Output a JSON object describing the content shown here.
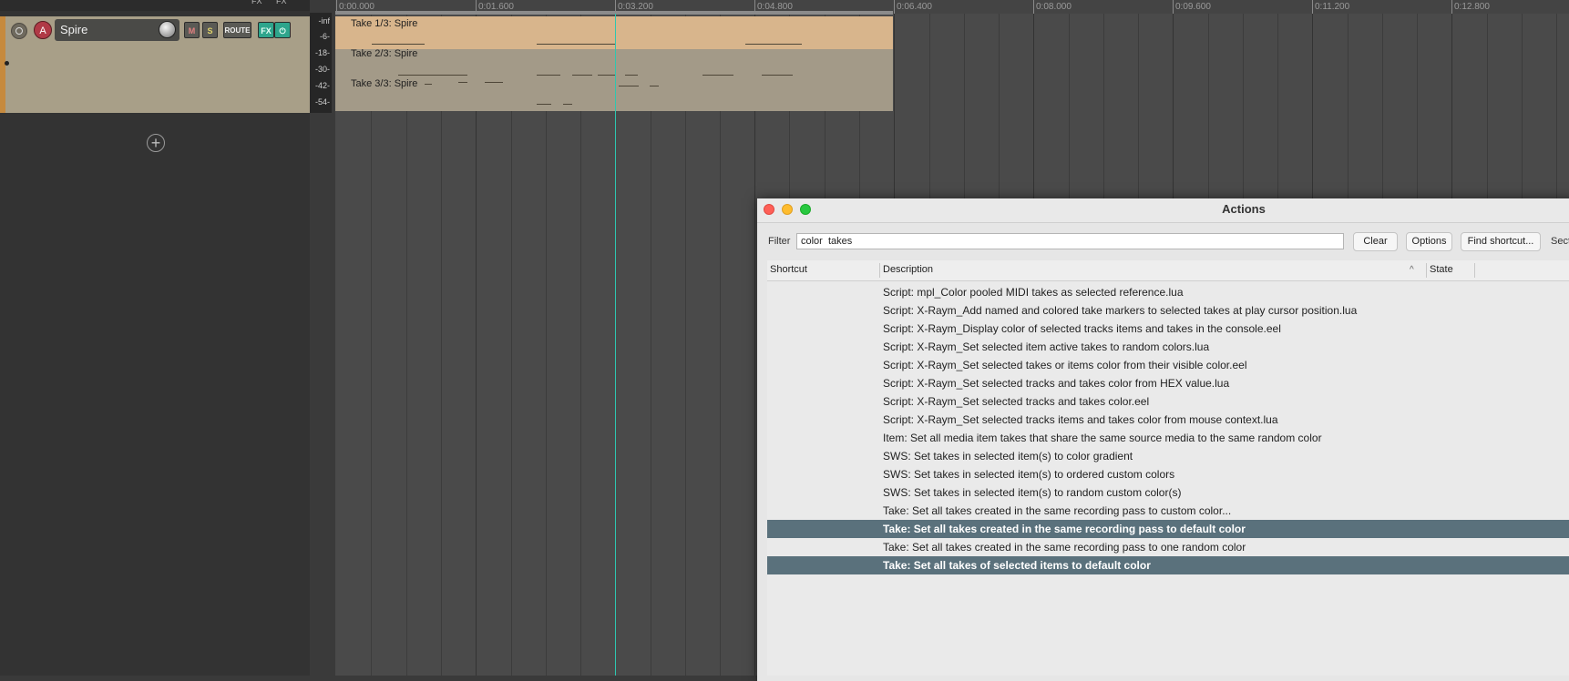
{
  "toolbar": {
    "fx_labels": [
      "FX",
      "FX"
    ]
  },
  "track": {
    "number": "A",
    "name": "Spire",
    "buttons": {
      "mute": "M",
      "solo": "S",
      "route": "ROUTE",
      "fx": "FX",
      "power": "⏻"
    },
    "meter_labels": [
      "-inf",
      "-6-",
      "-18-",
      "-30-",
      "-42-",
      "-54-"
    ]
  },
  "add_track_symbol": "+",
  "ruler": {
    "labels": [
      "0:00.000",
      "0:01.600",
      "0:03.200",
      "0:04.800",
      "0:06.400",
      "0:08.000",
      "0:09.600",
      "0:11.200",
      "0:12.800"
    ]
  },
  "item": {
    "takes": [
      "Take 1/3: Spire",
      "Take 2/3: Spire",
      "Take 3/3: Spire"
    ]
  },
  "actions_window": {
    "title": "Actions",
    "filter_label": "Filter",
    "filter_value": "color  takes",
    "buttons": {
      "clear": "Clear",
      "options": "Options",
      "find_shortcut": "Find shortcut...",
      "section": "Sect"
    },
    "columns": {
      "shortcut": "Shortcut",
      "description": "Description",
      "state": "State"
    },
    "rows": [
      {
        "description": "Script: mpl_Color pooled MIDI takes as selected reference.lua",
        "selected": false
      },
      {
        "description": "Script: X-Raym_Add named and colored take markers to selected takes at play cursor position.lua",
        "selected": false
      },
      {
        "description": "Script: X-Raym_Display color of selected tracks items and takes in the console.eel",
        "selected": false
      },
      {
        "description": "Script: X-Raym_Set selected item active takes to random colors.lua",
        "selected": false
      },
      {
        "description": "Script: X-Raym_Set selected takes or items color from their visible color.eel",
        "selected": false
      },
      {
        "description": "Script: X-Raym_Set selected tracks and takes color from HEX value.lua",
        "selected": false
      },
      {
        "description": "Script: X-Raym_Set selected tracks and takes color.eel",
        "selected": false
      },
      {
        "description": "Script: X-Raym_Set selected tracks items and takes color from mouse context.lua",
        "selected": false
      },
      {
        "description": "Item: Set all media item takes that share the same source media to the same random color",
        "selected": false
      },
      {
        "description": "SWS: Set takes in selected item(s) to color gradient",
        "selected": false
      },
      {
        "description": "SWS: Set takes in selected item(s) to ordered custom colors",
        "selected": false
      },
      {
        "description": "SWS: Set takes in selected item(s) to random custom color(s)",
        "selected": false
      },
      {
        "description": "Take: Set all takes created in the same recording pass to custom color...",
        "selected": false
      },
      {
        "description": "Take: Set all takes created in the same recording pass to default color",
        "selected": true
      },
      {
        "description": "Take: Set all takes created in the same recording pass to one random color",
        "selected": false
      },
      {
        "description": "Take: Set all takes of selected items to default color",
        "selected": true
      }
    ]
  }
}
